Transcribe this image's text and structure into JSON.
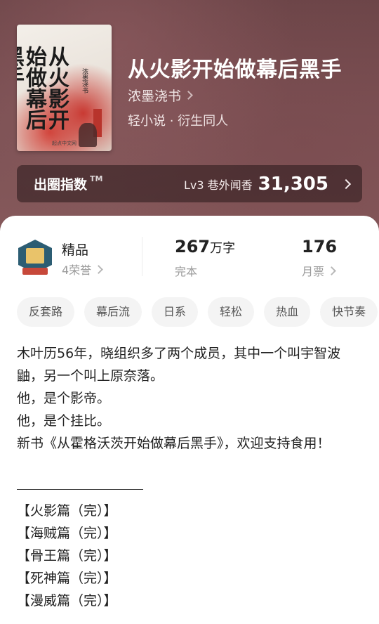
{
  "book": {
    "title": "从火影开始做幕后黑手",
    "author": "浓墨浇书",
    "genre": "轻小说 · 衍生同人",
    "cover": {
      "title": "从火影开始做幕后黑手",
      "author": "浓墨浇书",
      "publisher": "起点中文网"
    }
  },
  "index_bar": {
    "label": "出圈指数",
    "tm": "TM",
    "level": "Lv3 巷外闻香",
    "value": "31,305"
  },
  "stats": {
    "badge_ribbon": "",
    "quality": "精品",
    "honor": "4荣誉",
    "words_num": "267",
    "words_unit": "万字",
    "status": "完本",
    "tickets": "176",
    "tickets_label": "月票"
  },
  "tags": [
    "反套路",
    "幕后流",
    "日系",
    "轻松",
    "热血",
    "快节奏"
  ],
  "description": {
    "lines": [
      "木叶历56年，晓组织多了两个成员，其中一个叫宇智波鼬，另一个叫上原奈落。",
      "他，是个影帝。",
      "他，是个挂比。",
      "新书《从霍格沃茨开始做幕后黑手》，欢迎支持食用！"
    ]
  },
  "arcs": [
    "【火影篇（完）】",
    "【海贼篇（完）】",
    "【骨王篇（完）】",
    "【死神篇（完）】",
    "【漫威篇（完）】"
  ],
  "colors": {
    "hero_bg": "#7b5154",
    "accent_red": "#c93a33",
    "text_main": "#222222",
    "text_muted": "#9a9a9a",
    "tag_bg": "#f4f4f4"
  }
}
